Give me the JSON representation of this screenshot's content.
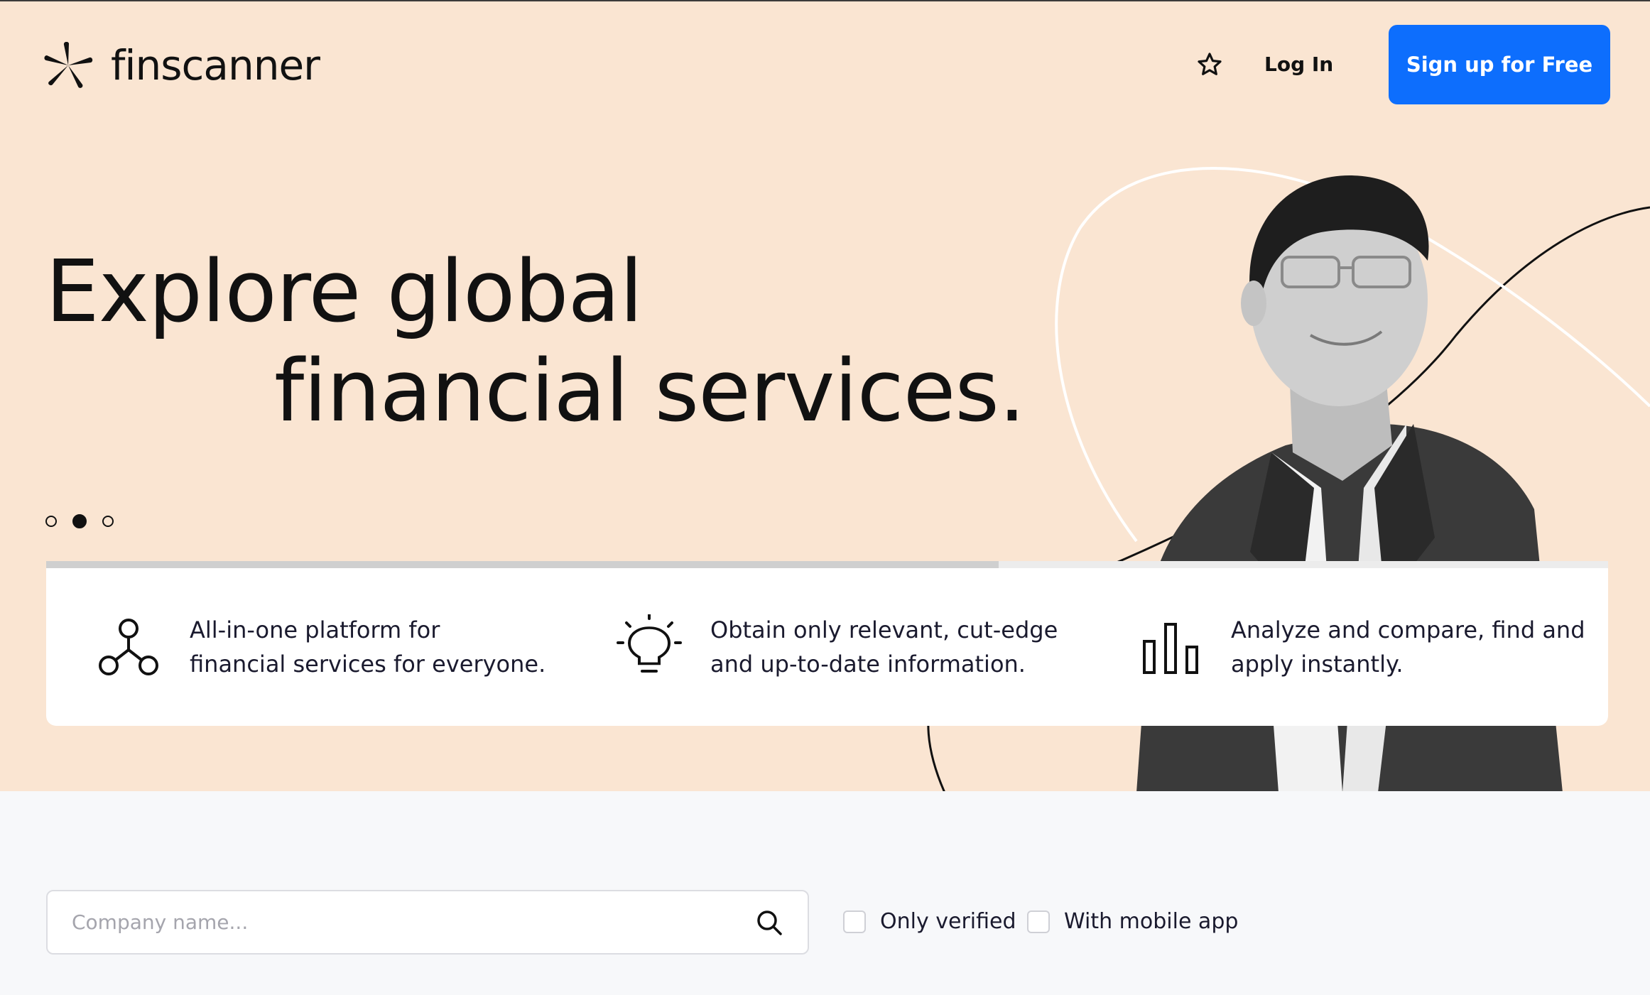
{
  "brand": {
    "name": "finscanner",
    "icon": "pinwheel-logo-icon"
  },
  "header": {
    "favorites_icon": "star-icon",
    "login_label": "Log In",
    "signup_label": "Sign up for Free"
  },
  "hero": {
    "headline_line1": "Explore global",
    "headline_line2": "financial services.",
    "slides": {
      "count": 3,
      "active_index": 1
    },
    "progress": 0.61
  },
  "features": [
    {
      "icon": "network-nodes-icon",
      "text": "All-in-one platform for\nfinancial services for everyone."
    },
    {
      "icon": "lightbulb-icon",
      "text": "Obtain only relevant, cut-edge\nand up-to-date information."
    },
    {
      "icon": "bar-chart-icon",
      "text": "Analyze and compare, find and\napply instantly."
    }
  ],
  "search": {
    "placeholder": "Company name...",
    "value": "",
    "icon": "search-icon"
  },
  "filters": [
    {
      "label": "Only verified",
      "checked": false
    },
    {
      "label": "With mobile app",
      "checked": false
    }
  ],
  "colors": {
    "hero_bg": "#fae5d2",
    "accent": "#0d6efd",
    "page_bg": "#f7f8fa",
    "text": "#111111"
  }
}
